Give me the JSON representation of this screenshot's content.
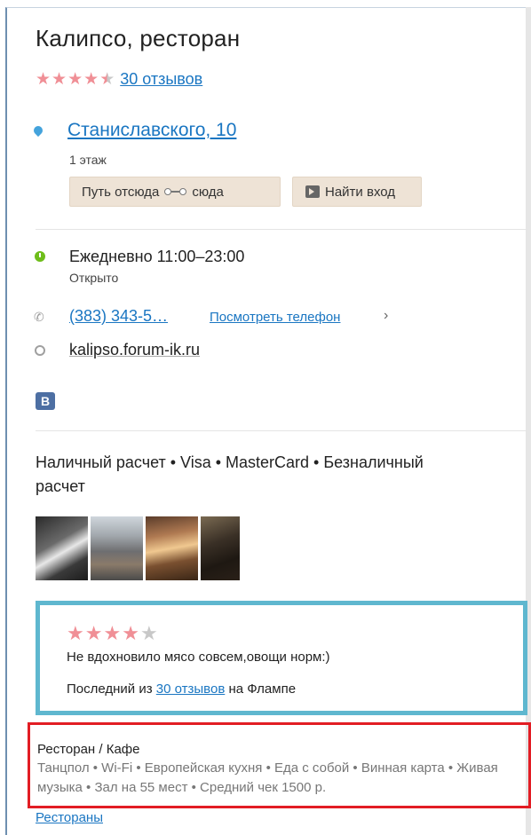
{
  "place": {
    "name": "Калипсо, ресторан",
    "rating_stars": 4.5,
    "reviews_link": "30 отзывов"
  },
  "address": {
    "street": "Станиславского, 10",
    "floor": "1 этаж",
    "route_from": "Путь отсюда",
    "route_to": "сюда",
    "find_entrance": "Найти вход"
  },
  "hours": {
    "schedule": "Ежедневно 11:00–23:00",
    "status": "Открыто"
  },
  "contacts": {
    "phone": "(383) 343-5…",
    "show_phone": "Посмотреть телефон",
    "website": "kalipso.forum-ik.ru",
    "vk_label": "B"
  },
  "payment": "Наличный расчет • Visa • MasterCard • Безналичный расчет",
  "review": {
    "stars": 4,
    "text": "Не вдохновило мясо совсем,овощи норм:)",
    "last_prefix": "Последний из",
    "last_link": "30 отзывов",
    "last_suffix": "на Флампе"
  },
  "category": {
    "title": "Ресторан / Кафе",
    "tags": "Танцпол • Wi-Fi • Европейская кухня • Еда с собой • Винная карта • Живая музыка • Зал на 55 мест • Средний чек 1500 р."
  },
  "bottom_link": "Рестораны",
  "icons": {
    "pin": "map-pin-icon",
    "clock": "clock-icon",
    "phone": "phone-icon",
    "web": "globe-icon",
    "vk": "vk-icon",
    "entrance": "entrance-icon"
  },
  "colors": {
    "link": "#1a76c2",
    "star": "#f08f96",
    "open": "#6ebd1a",
    "review_border": "#5fb7cf",
    "highlight_border": "#e21d24",
    "button_bg": "#eee3d6"
  }
}
